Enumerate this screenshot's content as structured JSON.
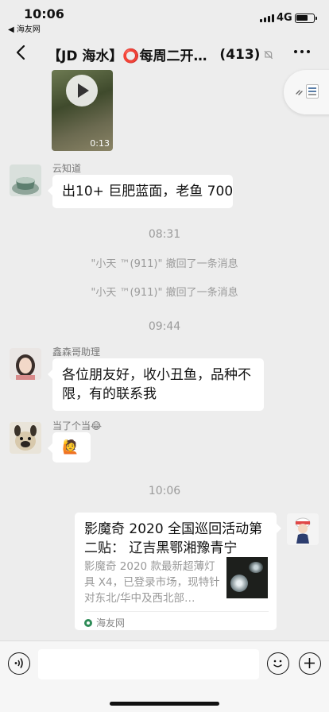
{
  "status_bar": {
    "time": "10:06",
    "back_app": "◀ 海友网",
    "network": "4G"
  },
  "nav": {
    "title": "【JD 海水】⭕每周二开团…",
    "member_count": "(413)"
  },
  "video": {
    "duration": "0:13"
  },
  "messages": [
    {
      "sender": "云知道",
      "text": "出10+ 巨肥蓝面，老鱼 700"
    },
    {
      "sender": "鑫森哥助理",
      "text": "各位朋友好，收小丑鱼，品种不限，有的联系我"
    },
    {
      "sender": "当了个当😂",
      "text": "🙋"
    }
  ],
  "timestamps": [
    "08:31",
    "09:44",
    "10:06"
  ],
  "system_messages": [
    "\"小天 ™(911)\" 撤回了一条消息",
    "\"小天 ™(911)\" 撤回了一条消息"
  ],
  "link_card": {
    "title": "影魔奇 2020 全国巡回活动第二贴：   辽吉黑鄂湘豫青宁",
    "description": "影魔奇 2020 款最新超薄灯具 X4，已登录市场，现特针对东北/华中及西北部…",
    "source": "海友网"
  }
}
